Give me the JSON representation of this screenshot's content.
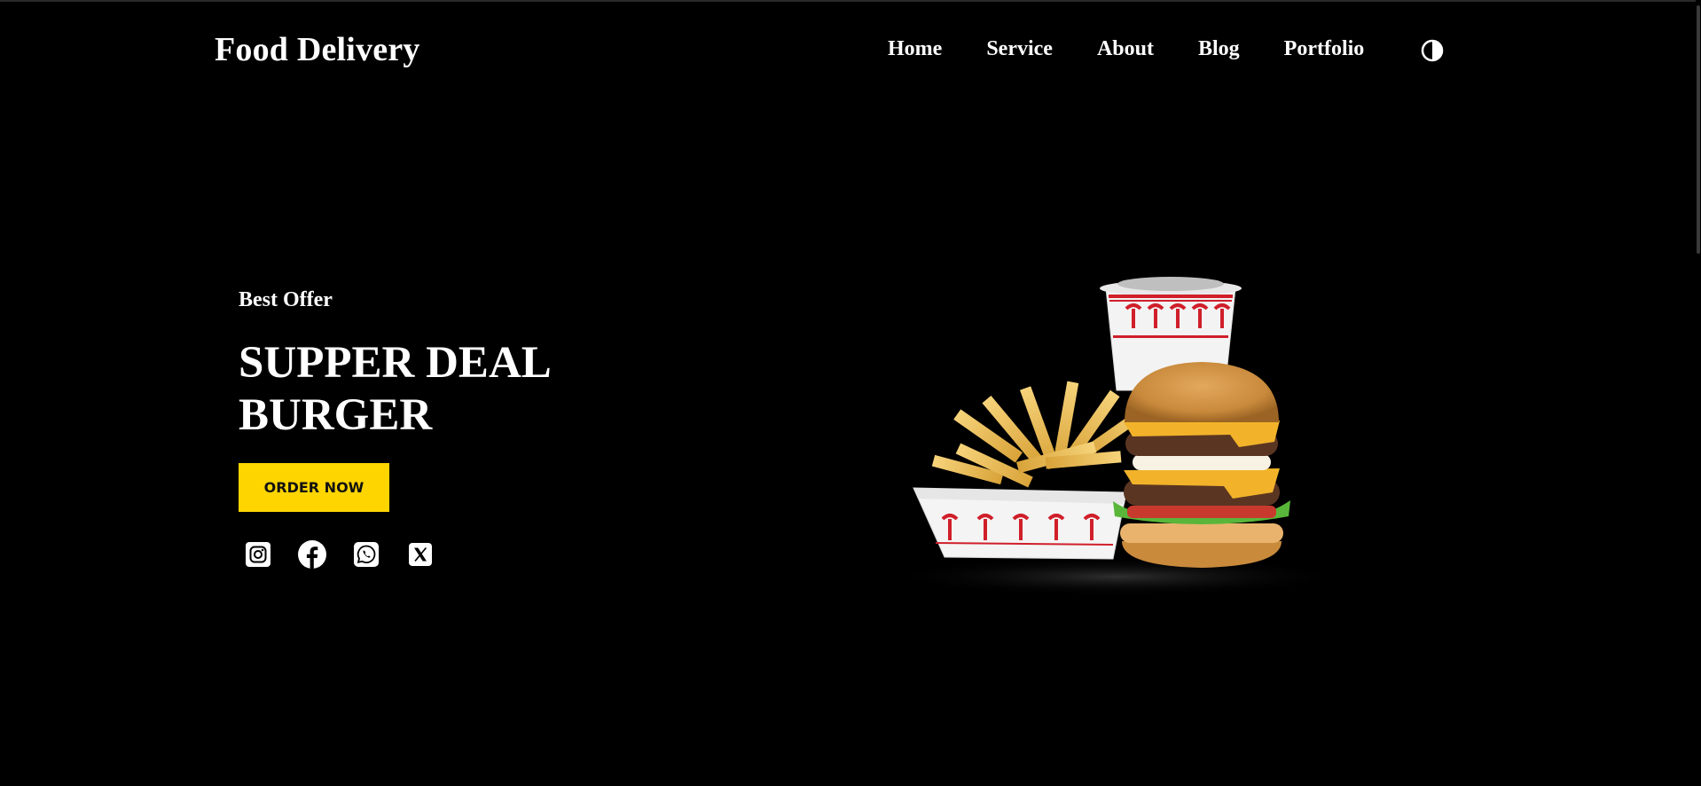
{
  "header": {
    "brand": "Food Delivery",
    "nav": [
      "Home",
      "Service",
      "About",
      "Blog",
      "Portfolio"
    ],
    "theme_toggle_icon": "contrast-icon"
  },
  "hero": {
    "eyebrow": "Best Offer",
    "title_line1": "SUPPER DEAL",
    "title_line2": "BURGER",
    "cta": "ORDER NOW",
    "cta_color": "#ffd500",
    "social": [
      "instagram-icon",
      "facebook-icon",
      "whatsapp-icon",
      "x-icon"
    ],
    "image": "burger-fries-drink-combo"
  }
}
